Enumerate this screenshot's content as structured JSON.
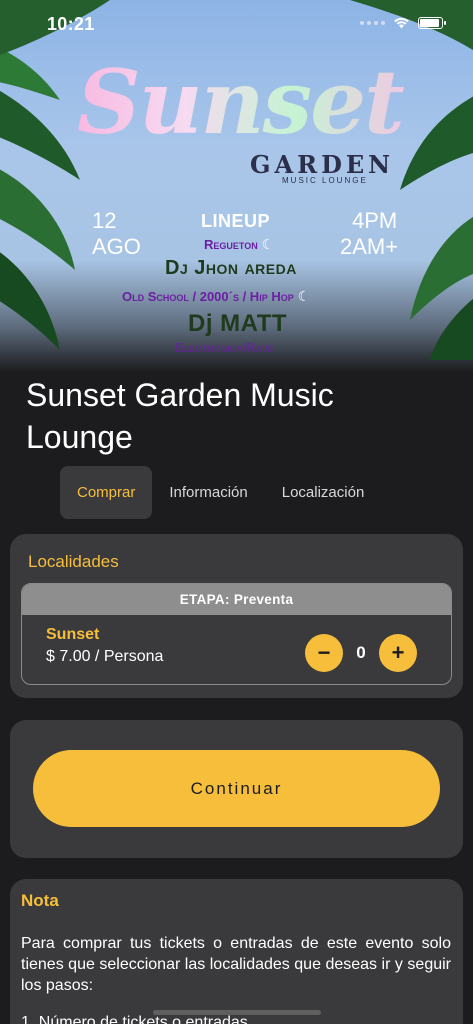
{
  "status_bar": {
    "time": "10:21",
    "icons": [
      "signal-icon",
      "wifi-icon",
      "battery-icon"
    ]
  },
  "poster": {
    "title": "Sunset",
    "subtitle": "GARDEN",
    "tagline": "MUSIC LOUNGE",
    "date_day": "12",
    "date_month": "AGO",
    "time_start": "4PM",
    "time_end": "2AM+",
    "lineup_label": "LINEUP",
    "genre1": "Regueton",
    "dj1": "Dj Jhon areda",
    "genre2": "Old School / 2000´s / Hip Hop",
    "dj2": "Dj MATT",
    "genre3": "Electrónica/Rave"
  },
  "event": {
    "title": "Sunset Garden Music Lounge"
  },
  "tabs": [
    {
      "label": "Comprar",
      "active": true
    },
    {
      "label": "Información",
      "active": false
    },
    {
      "label": "Localización",
      "active": false
    }
  ],
  "localidades": {
    "title": "Localidades",
    "stage": "ETAPA: Preventa",
    "ticket": {
      "name": "Sunset",
      "price": "$ 7.00 / Persona",
      "quantity": "0",
      "minus": "−",
      "plus": "+"
    }
  },
  "continue_label": "Continuar",
  "nota": {
    "title": "Nota",
    "body": "Para comprar tus tickets o entradas de este evento solo tienes que seleccionar las localidades que deseas ir y seguir los pasos:",
    "step1": "1. Número de tickets o entradas"
  },
  "colors": {
    "accent": "#f6be3b",
    "background": "#1c1c1e",
    "card": "#3a3a3c"
  }
}
